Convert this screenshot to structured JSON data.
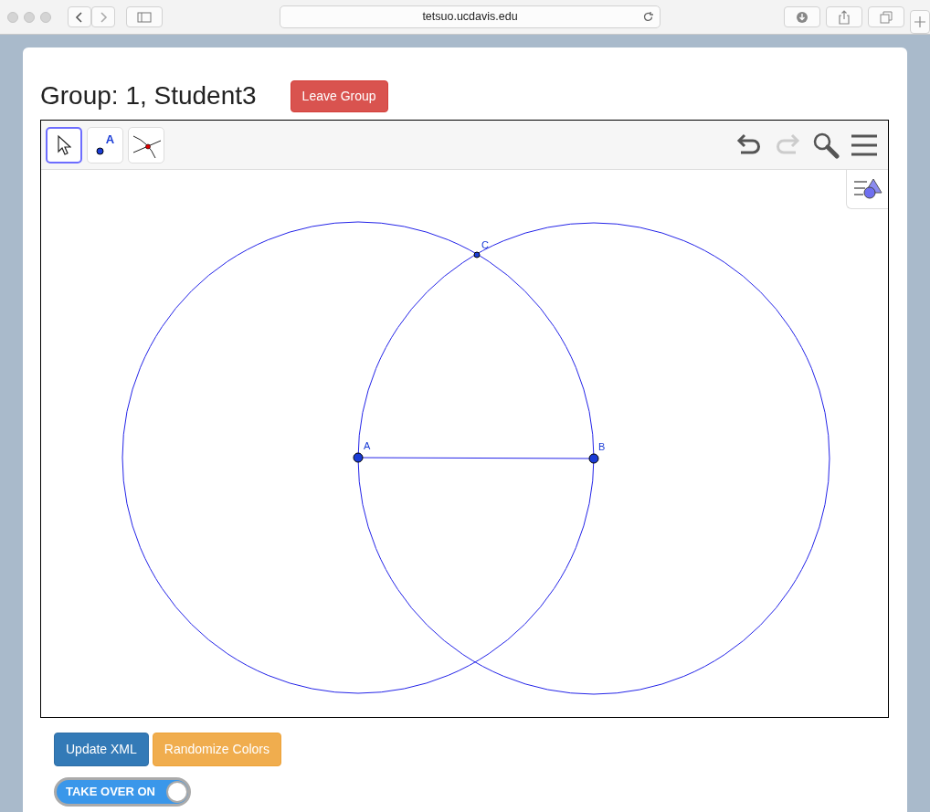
{
  "browser": {
    "address": "tetsuo.ucdavis.edu"
  },
  "header": {
    "title": "Group: 1, Student3",
    "leave_button": "Leave Group"
  },
  "tools": [
    {
      "kind": "move",
      "selected": true
    },
    {
      "kind": "point",
      "label": "A",
      "selected": false
    },
    {
      "kind": "intersect",
      "selected": false
    }
  ],
  "actions": [
    {
      "kind": "undo",
      "disabled": false
    },
    {
      "kind": "redo",
      "disabled": true
    },
    {
      "kind": "zoom",
      "disabled": false
    },
    {
      "kind": "menu",
      "disabled": false
    }
  ],
  "points": [
    {
      "label": "A"
    },
    {
      "label": "B"
    },
    {
      "label": "C"
    }
  ],
  "buttons": [
    {
      "label": "Update XML",
      "kind": "primary"
    },
    {
      "label": "Randomize Colors",
      "kind": "warning"
    }
  ],
  "take_over": {
    "label": "TAKE OVER ON",
    "on": true
  }
}
